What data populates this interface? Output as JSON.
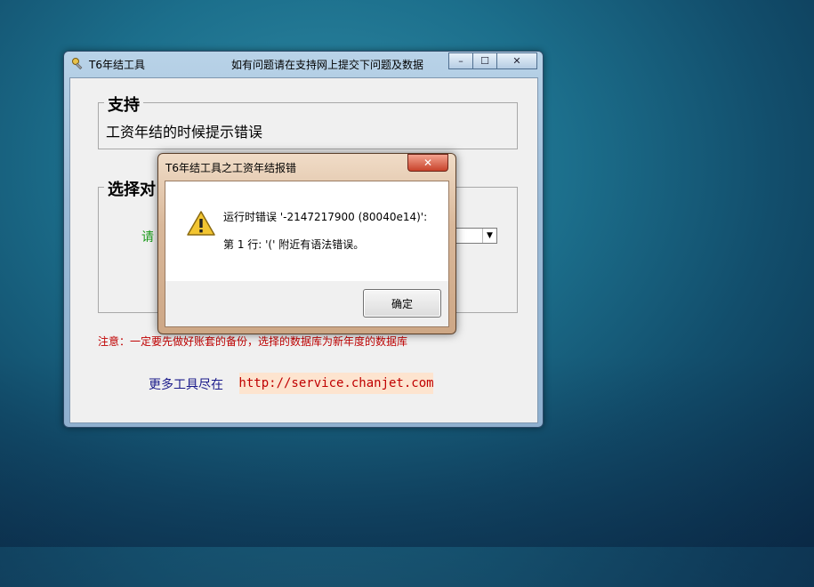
{
  "main_window": {
    "title": "T6年结工具",
    "title_note": "如有问题请在支持网上提交下问题及数据",
    "controls": {
      "minimize": "–",
      "maximize": "☐",
      "close": "✕"
    },
    "support_group": {
      "legend": "支持",
      "text": "工资年结的时候提示错误"
    },
    "select_group": {
      "legend": "选择对",
      "label": "请"
    },
    "notice": "注意：一定要先做好账套的备份，选择的数据库为新年度的数据库",
    "more_tools_label": "更多工具尽在",
    "link": "http://service.chanjet.com"
  },
  "dialog": {
    "title": "T6年结工具之工资年结报错",
    "close_glyph": "✕",
    "icon": "warning-icon",
    "message_line1": "运行时错误 '-2147217900 (80040e14)':",
    "message_line2": "第 1 行: '(' 附近有语法错误。",
    "ok_label": "确定"
  }
}
